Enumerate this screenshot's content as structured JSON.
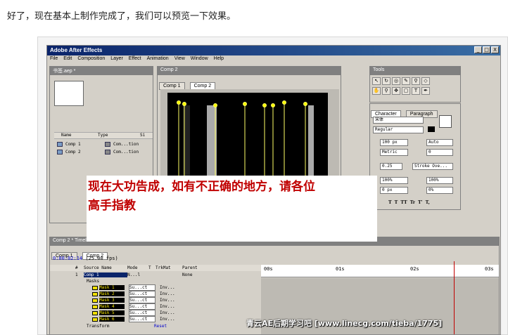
{
  "intro_text": "好了，现在基本上制作完成了，我们可以预览一下效果。",
  "window": {
    "title": "Adobe After Effects",
    "min": "_",
    "max": "□",
    "close": "X"
  },
  "menu": [
    "File",
    "Edit",
    "Composition",
    "Layer",
    "Effect",
    "Animation",
    "View",
    "Window",
    "Help"
  ],
  "project": {
    "title": "书签.aep *",
    "columns": [
      "Name",
      "Type",
      "Si"
    ],
    "items": [
      {
        "name": "Comp 1",
        "type": "Com...tion"
      },
      {
        "name": "Comp 2",
        "type": "Com...tion"
      }
    ]
  },
  "composition": {
    "title": "Comp 2",
    "tabs": [
      "Comp 1",
      "Comp 2"
    ]
  },
  "tools": {
    "title": "Tools"
  },
  "character": {
    "tabs": [
      "Character",
      "Paragraph"
    ],
    "font": "宋体",
    "style": "Regular",
    "size": "100 px",
    "leading": "Auto",
    "kerning": "Metric",
    "tracking": "0",
    "stroke_width": "0.25",
    "stroke_mode": "Stroke Ove...",
    "vscale": "100%",
    "hscale": "100%",
    "baseline": "0 px",
    "tsume": "0%",
    "styles": [
      "T",
      "T",
      "TT",
      "Tr",
      "T'",
      "T,"
    ]
  },
  "overlay_text": [
    "现在大功告成，如有不正确的地方，请各位",
    "高手指教"
  ],
  "timeline": {
    "title": "Comp 2 * Timeline",
    "tabs": [
      "Comp 1",
      "Comp 2"
    ],
    "timecode": "0:00:02:14",
    "fps": "(25.00 fps)",
    "columns": [
      "#",
      "Source Name",
      "Mode",
      "T",
      "TrkMat",
      "Parent"
    ],
    "ruler": [
      "00s",
      "01s",
      "02s",
      "03s"
    ],
    "layer": {
      "num": "1",
      "name": "Comp 1",
      "mode": "N...l",
      "parent": "None"
    },
    "masks_label": "Masks",
    "masks": [
      "Mask 1",
      "Mask 2",
      "Mask 3",
      "Mask 4",
      "Mask 5",
      "Mask 6"
    ],
    "mask_mode": "Su...ct",
    "mask_inv": "Inv...",
    "transform_label": "Transform",
    "transform_reset": "Reset"
  },
  "watermark": "青云AE后期学习吧 [www.linecg.com/tieba/1775]",
  "colors": {
    "accent_red": "#c00000",
    "title_blue": "#0a246a",
    "mask_yellow": "#f0e000"
  }
}
